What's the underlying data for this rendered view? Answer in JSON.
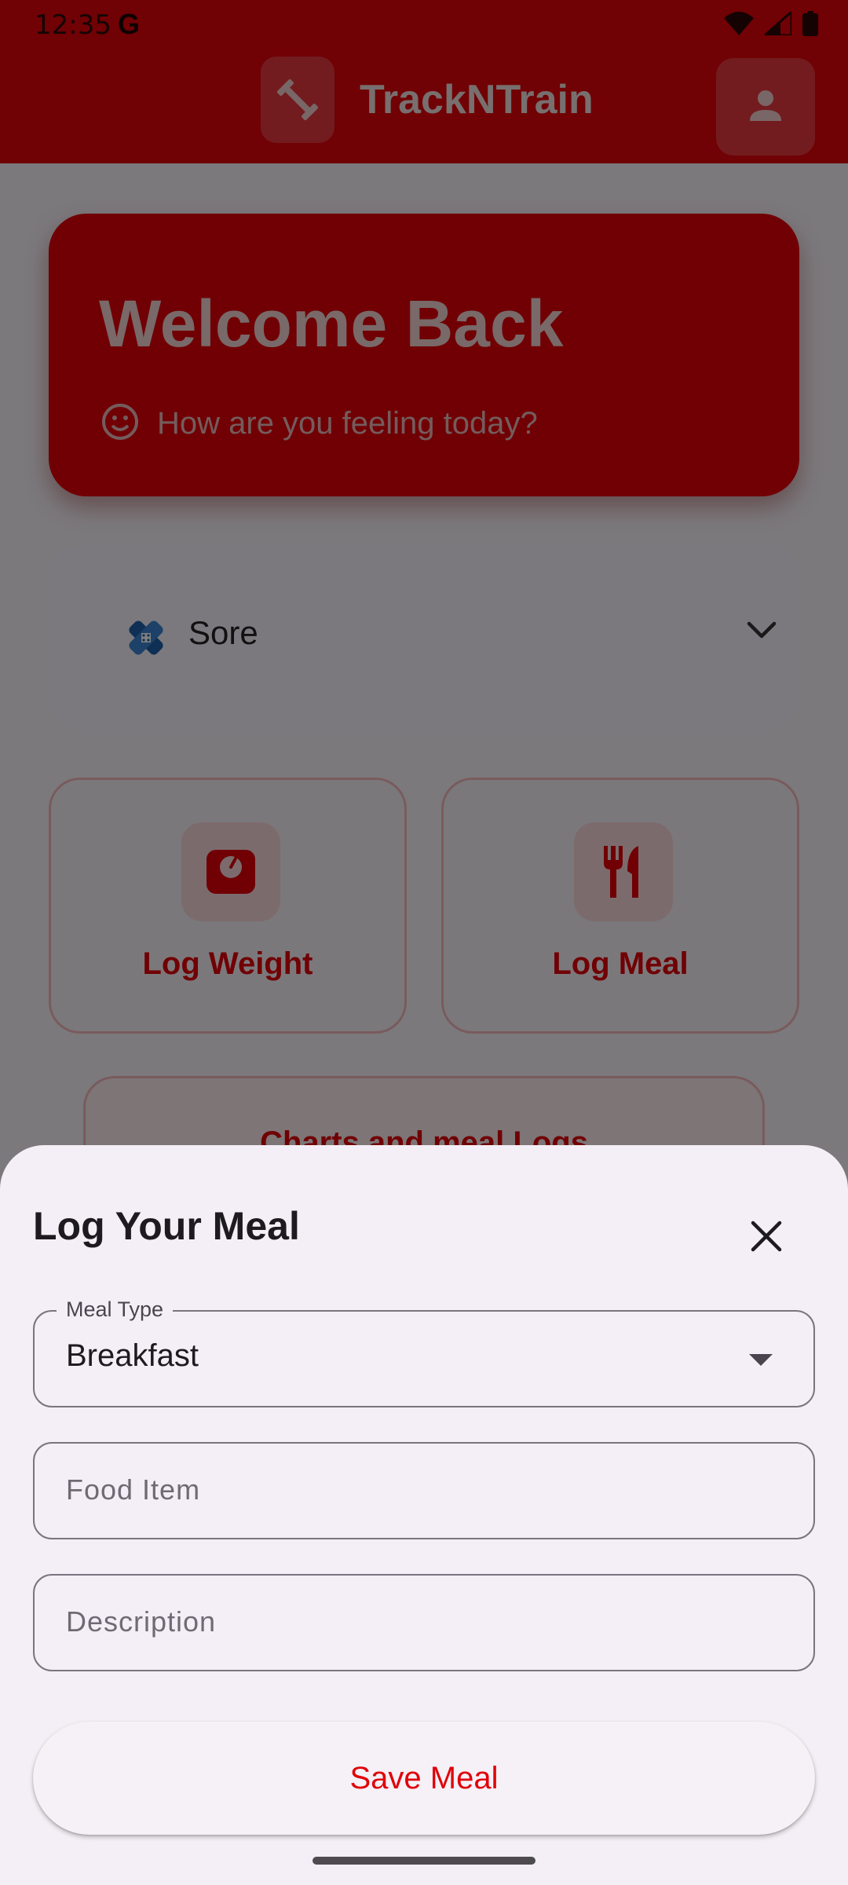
{
  "status_bar": {
    "time": "12:35",
    "g_label": "G"
  },
  "app_bar": {
    "title": "TrackNTrain",
    "logo_icon": "dumbbell-icon",
    "profile_icon": "person-icon"
  },
  "welcome": {
    "title": "Welcome Back",
    "subtitle": "How are you feeling today?",
    "subtitle_icon": "smiley-icon"
  },
  "mood": {
    "selected": "Sore",
    "icon": "bandage-icon"
  },
  "actions": [
    {
      "label": "Log Weight",
      "icon": "scale-icon"
    },
    {
      "label": "Log Meal",
      "icon": "fork-knife-icon"
    }
  ],
  "charts_link": {
    "label": "Charts and meal Logs"
  },
  "sheet": {
    "title": "Log Your Meal",
    "meal_type": {
      "label": "Meal Type",
      "value": "Breakfast"
    },
    "food_item": {
      "placeholder": "Food Item"
    },
    "description": {
      "placeholder": "Description"
    },
    "save_label": "Save Meal"
  },
  "colors": {
    "brand": "#e00008",
    "sheet_bg": "#f4eff6"
  }
}
